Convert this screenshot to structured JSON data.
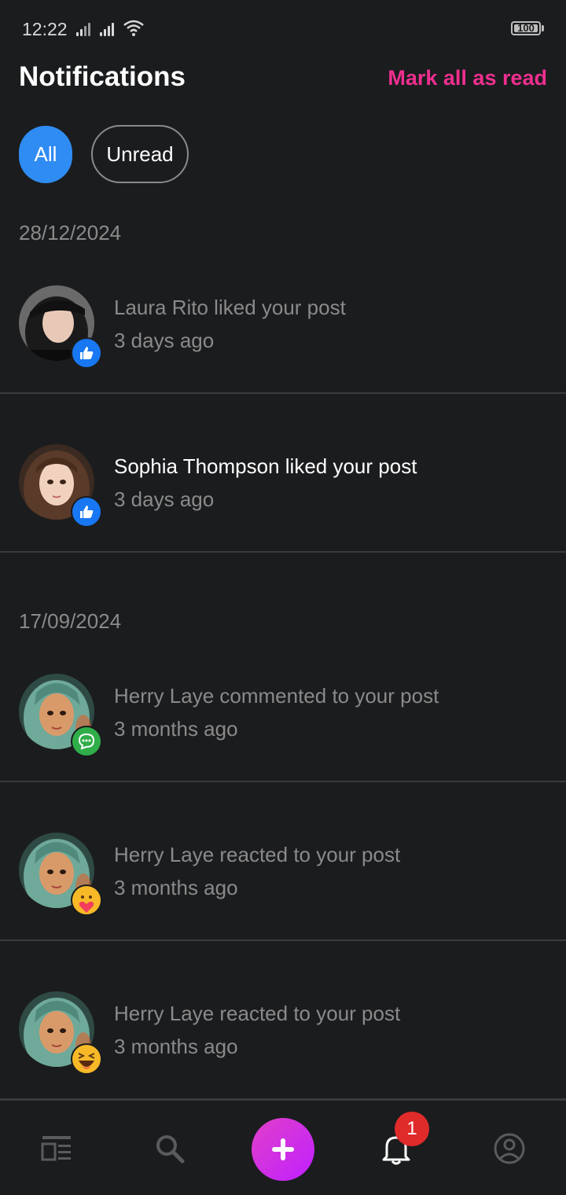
{
  "status_bar": {
    "time": "12:22",
    "battery": "100"
  },
  "header": {
    "title": "Notifications",
    "mark_all_label": "Mark all as read"
  },
  "tabs": {
    "all": "All",
    "unread": "Unread"
  },
  "groups": [
    {
      "date": "28/12/2024",
      "items": [
        {
          "text": "Laura Rito liked your post",
          "time": "3 days ago",
          "badge": "thumbs-up-icon",
          "unread": false
        },
        {
          "text": "Sophia Thompson liked your post",
          "time": "3 days ago",
          "badge": "thumbs-up-icon",
          "unread": true
        }
      ]
    },
    {
      "date": "17/09/2024",
      "items": [
        {
          "text": "Herry Laye commented to your post",
          "time": "3 months ago",
          "badge": "comment-icon",
          "unread": false
        },
        {
          "text": "Herry Laye reacted to your post",
          "time": "3 months ago",
          "badge": "care-emoji-icon",
          "unread": false
        },
        {
          "text": "Herry Laye reacted to your post",
          "time": "3 months ago",
          "badge": "haha-emoji-icon",
          "unread": false
        }
      ]
    }
  ],
  "bottom_nav": {
    "notification_count": "1"
  },
  "colors": {
    "accent_pink": "#ef2f8f",
    "tab_active": "#2f8cf2",
    "badge_red": "#e02b2b",
    "like_blue": "#1877f2",
    "comment_green": "#2fae49"
  }
}
